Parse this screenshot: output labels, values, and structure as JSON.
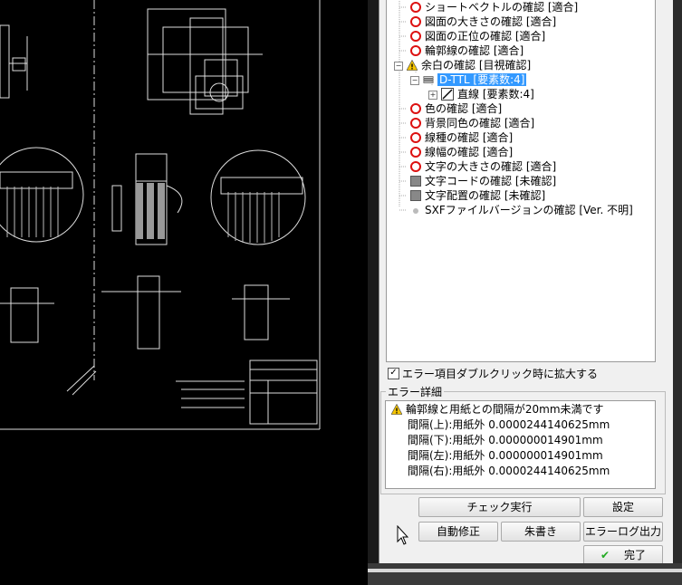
{
  "tree": {
    "items": [
      {
        "label": "ショートベクトルの確認 [適合]",
        "icon": "red-circle-icon"
      },
      {
        "label": "図面の大きさの確認 [適合]",
        "icon": "red-circle-icon"
      },
      {
        "label": "図面の正位の確認 [適合]",
        "icon": "red-circle-icon"
      },
      {
        "label": "輪郭線の確認 [適合]",
        "icon": "red-circle-icon"
      },
      {
        "label": "余白の確認 [目視確認]",
        "icon": "warning-icon"
      },
      {
        "label": "D-TTL [要素数:4]",
        "icon": "layer-icon"
      },
      {
        "label": "直線 [要素数:4]",
        "icon": "line-icon"
      },
      {
        "label": "色の確認 [適合]",
        "icon": "red-circle-icon"
      },
      {
        "label": "背景同色の確認 [適合]",
        "icon": "red-circle-icon"
      },
      {
        "label": "線種の確認 [適合]",
        "icon": "red-circle-icon"
      },
      {
        "label": "線幅の確認 [適合]",
        "icon": "red-circle-icon"
      },
      {
        "label": "文字の大きさの確認 [適合]",
        "icon": "red-circle-icon"
      },
      {
        "label": "文字コードの確認 [未確認]",
        "icon": "grey-square-icon"
      },
      {
        "label": "文字配置の確認 [未確認]",
        "icon": "grey-square-icon"
      },
      {
        "label": "SXFファイルバージョンの確認 [Ver. 不明]",
        "icon": "grey-dot-icon"
      }
    ]
  },
  "zoom_checkbox": {
    "label": "エラー項目ダブルクリック時に拡大する",
    "checked": true
  },
  "detail": {
    "group_label": "エラー詳細",
    "lines": [
      "輪郭線と用紙との間隔が20mm未満です",
      "間隔(上):用紙外 0.0000244140625mm",
      "間隔(下):用紙外 0.000000014901mm",
      "間隔(左):用紙外 0.000000014901mm",
      "間隔(右):用紙外 0.0000244140625mm"
    ]
  },
  "buttons": {
    "run": "チェック実行",
    "settings": "設定",
    "autofix": "自動修正",
    "redline": "朱書き",
    "errorlog": "エラーログ出力",
    "done": "完了"
  }
}
